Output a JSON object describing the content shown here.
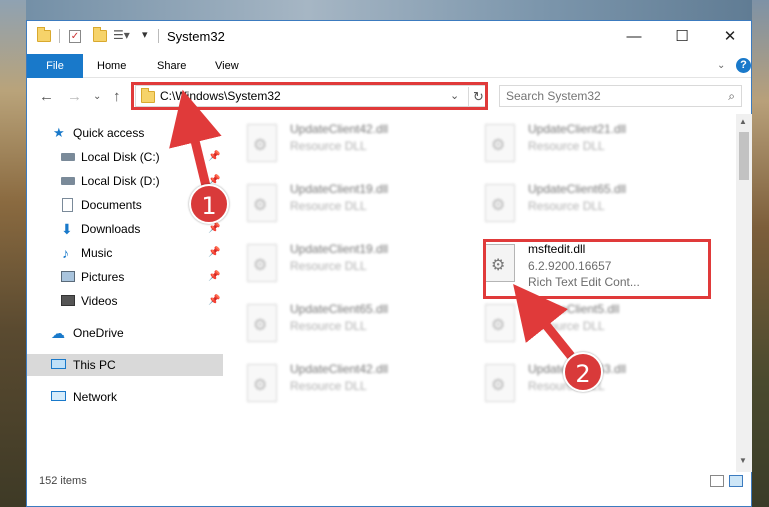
{
  "window": {
    "title": "System32",
    "min_glyph": "—",
    "max_glyph": "☐",
    "close_glyph": "✕"
  },
  "ribbon": {
    "tabs": [
      "File",
      "Home",
      "Share",
      "View"
    ]
  },
  "address_bar": {
    "path": "C:\\Windows\\System32"
  },
  "search": {
    "placeholder": "Search System32"
  },
  "sidebar": {
    "items": [
      {
        "label": "Quick access",
        "icon": "star-icon",
        "pinned": false
      },
      {
        "label": "Local Disk (C:)",
        "icon": "drive-icon",
        "pinned": true
      },
      {
        "label": "Local Disk (D:)",
        "icon": "drive-icon",
        "pinned": true
      },
      {
        "label": "Documents",
        "icon": "documents-icon",
        "pinned": true
      },
      {
        "label": "Downloads",
        "icon": "download-icon",
        "pinned": true
      },
      {
        "label": "Music",
        "icon": "music-icon",
        "pinned": true
      },
      {
        "label": "Pictures",
        "icon": "pictures-icon",
        "pinned": true
      },
      {
        "label": "Videos",
        "icon": "videos-icon",
        "pinned": true
      },
      {
        "label": "OneDrive",
        "icon": "cloud-icon",
        "pinned": false
      },
      {
        "label": "This PC",
        "icon": "computer-icon",
        "pinned": false,
        "selected": true
      },
      {
        "label": "Network",
        "icon": "network-icon",
        "pinned": false
      }
    ]
  },
  "files": {
    "left_column": [
      {
        "name": "UpdateClient42.dll",
        "type": "Resource DLL"
      },
      {
        "name": "UpdateClient19.dll",
        "type": "Resource DLL"
      },
      {
        "name": "UpdateClient19.dll",
        "type": "Resource DLL"
      },
      {
        "name": "UpdateClient65.dll",
        "type": "Resource DLL"
      },
      {
        "name": "UpdateClient42.dll",
        "type": "Resource DLL"
      }
    ],
    "right_column": [
      {
        "name": "UpdateClient21.dll",
        "type": "Resource DLL"
      },
      {
        "name": "UpdateClient65.dll",
        "type": "Resource DLL"
      },
      {
        "name": "UpdateClient5.dll",
        "type": "Resource DLL"
      },
      {
        "name": "UpdateClient63.dll",
        "type": "Resource DLL"
      }
    ],
    "highlighted": {
      "name": "msftedit.dll",
      "version": "6.2.9200.16657",
      "description": "Rich Text Edit Cont..."
    }
  },
  "status": {
    "count": "152 items"
  },
  "annotations": {
    "badge1": "1",
    "badge2": "2",
    "color": "#e03a3a"
  },
  "colors": {
    "accent": "#1979ca",
    "selected_nav": "#d9d9d9"
  }
}
